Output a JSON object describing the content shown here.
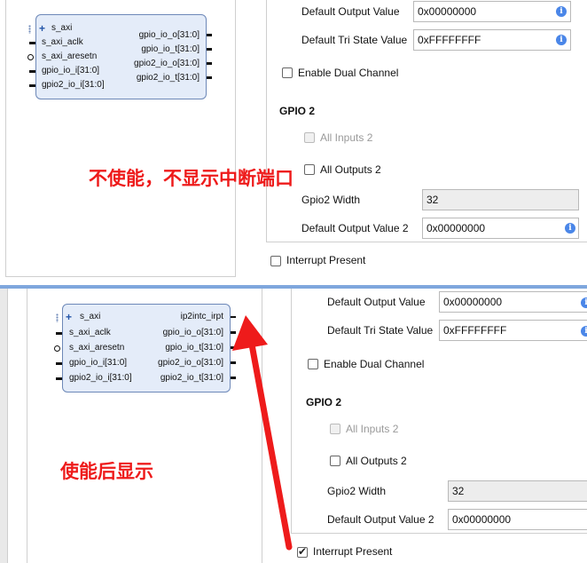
{
  "top": {
    "block": {
      "left_ports": [
        "s_axi",
        "s_axi_aclk",
        "s_axi_aresetn",
        "gpio_io_i[31:0]",
        "gpio2_io_i[31:0]"
      ],
      "right_ports": [
        "gpio_io_o[31:0]",
        "gpio_io_t[31:0]",
        "gpio2_io_o[31:0]",
        "gpio2_io_t[31:0]"
      ]
    },
    "default_output_label": "Default Output Value",
    "default_output_value": "0x00000000",
    "default_tri_label": "Default Tri State Value",
    "default_tri_value": "0xFFFFFFFF",
    "dual_channel_label": "Enable Dual Channel",
    "gpio2_title": "GPIO 2",
    "all_inputs2_label": "All Inputs 2",
    "all_outputs2_label": "All Outputs 2",
    "gpio2_width_label": "Gpio2 Width",
    "gpio2_width_value": "32",
    "default_output2_label": "Default Output Value 2",
    "default_output2_value": "0x00000000",
    "interrupt_label": "Interrupt Present",
    "interrupt_checked": false,
    "annotation": "不使能，不显示中断端口"
  },
  "bottom": {
    "block": {
      "left_ports": [
        "s_axi",
        "s_axi_aclk",
        "s_axi_aresetn",
        "gpio_io_i[31:0]",
        "gpio2_io_i[31:0]"
      ],
      "right_ports": [
        "ip2intc_irpt",
        "gpio_io_o[31:0]",
        "gpio_io_t[31:0]",
        "gpio2_io_o[31:0]",
        "gpio2_io_t[31:0]"
      ]
    },
    "default_output_label": "Default Output Value",
    "default_output_value": "0x00000000",
    "default_tri_label": "Default Tri State Value",
    "default_tri_value": "0xFFFFFFFF",
    "dual_channel_label": "Enable Dual Channel",
    "gpio2_title": "GPIO 2",
    "all_inputs2_label": "All Inputs 2",
    "all_outputs2_label": "All Outputs 2",
    "gpio2_width_label": "Gpio2 Width",
    "gpio2_width_value": "32",
    "default_output2_label": "Default Output Value 2",
    "default_output2_value": "0x00000000",
    "interrupt_label": "Interrupt Present",
    "interrupt_checked": true,
    "annotation": "使能后显示"
  },
  "colors": {
    "annotation": "#ee1b1b",
    "info_icon": "#4a86e8",
    "block_fill": "#e4ecf9",
    "divider": "#7fa7dd"
  }
}
